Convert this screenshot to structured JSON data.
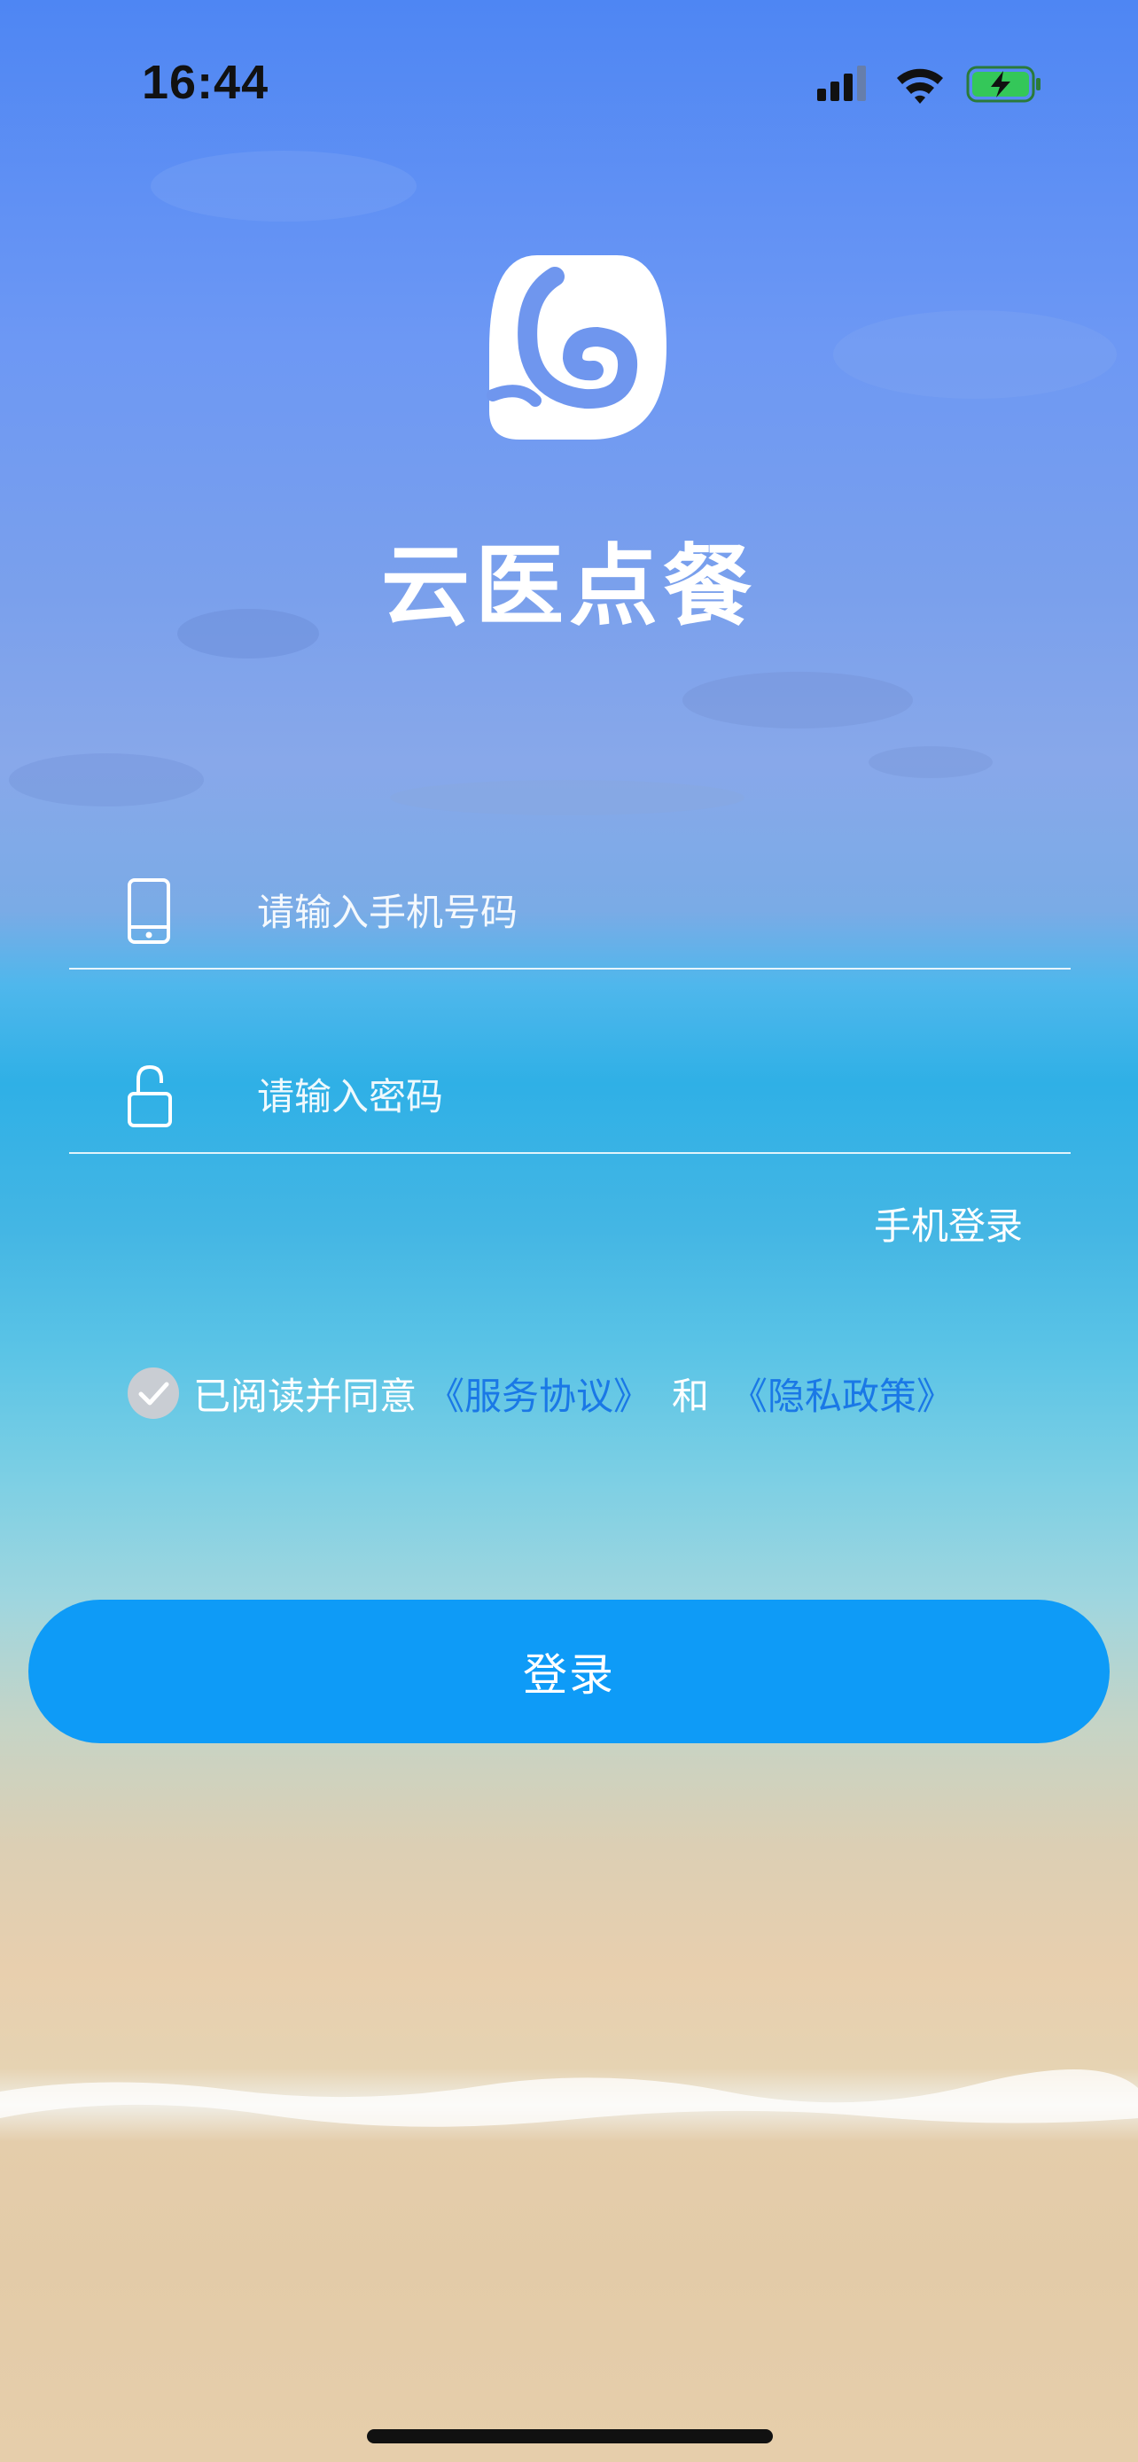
{
  "status_bar": {
    "time": "16:44",
    "icons": [
      "cellular-signal-icon",
      "wifi-icon",
      "battery-charging-icon"
    ],
    "battery_color": "#34c759"
  },
  "app": {
    "logo_icon": "app-logo-icon",
    "name": "云医点餐"
  },
  "form": {
    "phone": {
      "icon": "phone-icon",
      "placeholder": "请输入手机号码",
      "value": ""
    },
    "password": {
      "icon": "unlock-icon",
      "placeholder": "请输入密码",
      "value": ""
    },
    "phone_login_link": "手机登录"
  },
  "agreement": {
    "checked": true,
    "prefix": "已阅读并同意",
    "service_link": "《服务协议》",
    "and": "和",
    "privacy_link": "《隐私政策》",
    "link_color": "#1a78e6"
  },
  "login_button": {
    "label": "登录",
    "color": "#0e9bf7"
  }
}
